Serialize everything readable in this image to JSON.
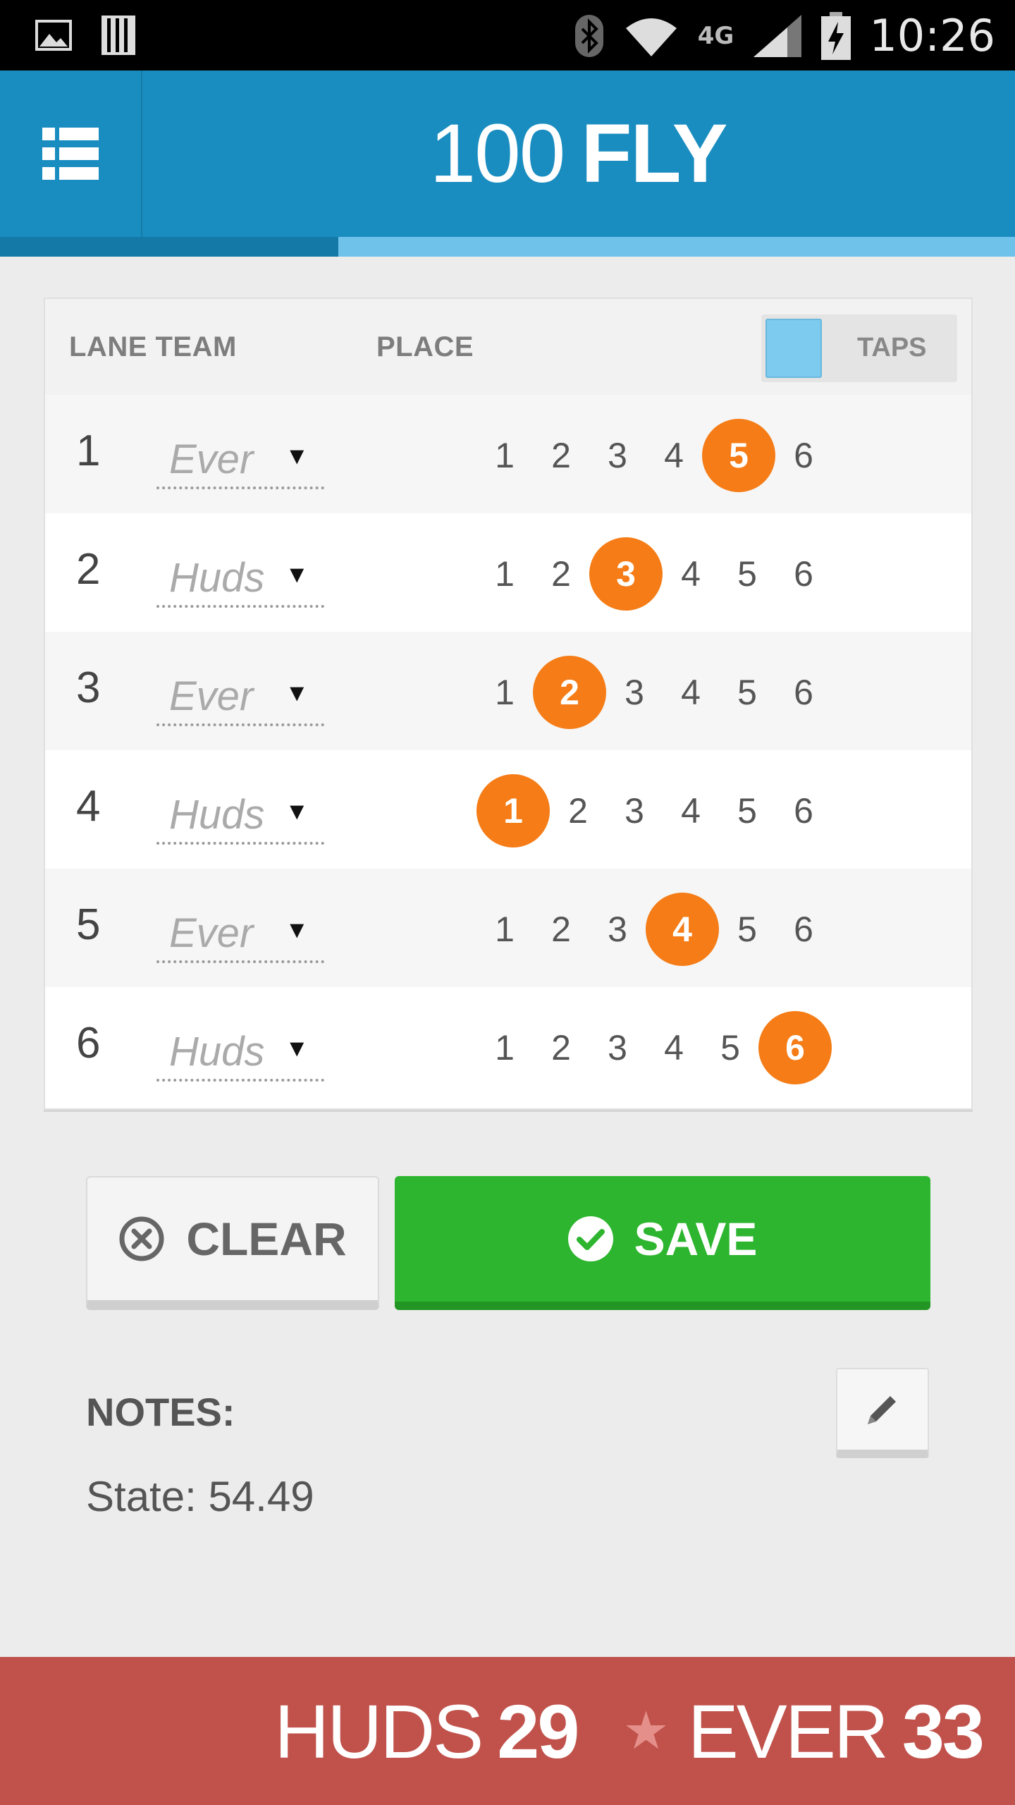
{
  "status_bar": {
    "network": "4G",
    "time": "10:26"
  },
  "header": {
    "event_number": "100",
    "event_stroke": "FLY",
    "progress_fraction": 0.333
  },
  "table": {
    "headers": {
      "lane_team": "LANE TEAM",
      "place": "PLACE",
      "toggle_label": "TAPS"
    },
    "rows": [
      {
        "lane": "1",
        "team": "Ever",
        "selected_place": 5
      },
      {
        "lane": "2",
        "team": "Huds",
        "selected_place": 3
      },
      {
        "lane": "3",
        "team": "Ever",
        "selected_place": 2
      },
      {
        "lane": "4",
        "team": "Huds",
        "selected_place": 1
      },
      {
        "lane": "5",
        "team": "Ever",
        "selected_place": 4
      },
      {
        "lane": "6",
        "team": "Huds",
        "selected_place": 6
      }
    ],
    "place_options": [
      "1",
      "2",
      "3",
      "4",
      "5",
      "6"
    ],
    "dropdown_arrow": "▼"
  },
  "actions": {
    "clear_label": "CLEAR",
    "save_label": "SAVE"
  },
  "notes": {
    "heading": "NOTES:",
    "text": "State: 54.49"
  },
  "scores": {
    "team1_name": "HUDS",
    "team1_points": "29",
    "star": "★",
    "team2_name": "EVER",
    "team2_points": "33"
  },
  "colors": {
    "app_bar": "#1a8dc0",
    "selected_place": "#f57c16",
    "save": "#2db52f",
    "score_bar": "#c0524b"
  },
  "icons": [
    "image-icon",
    "sd-card-icon",
    "bluetooth-icon",
    "wifi-icon",
    "signal-icon",
    "battery-icon",
    "list-menu-icon",
    "clear-x-icon",
    "check-icon",
    "pencil-icon"
  ]
}
